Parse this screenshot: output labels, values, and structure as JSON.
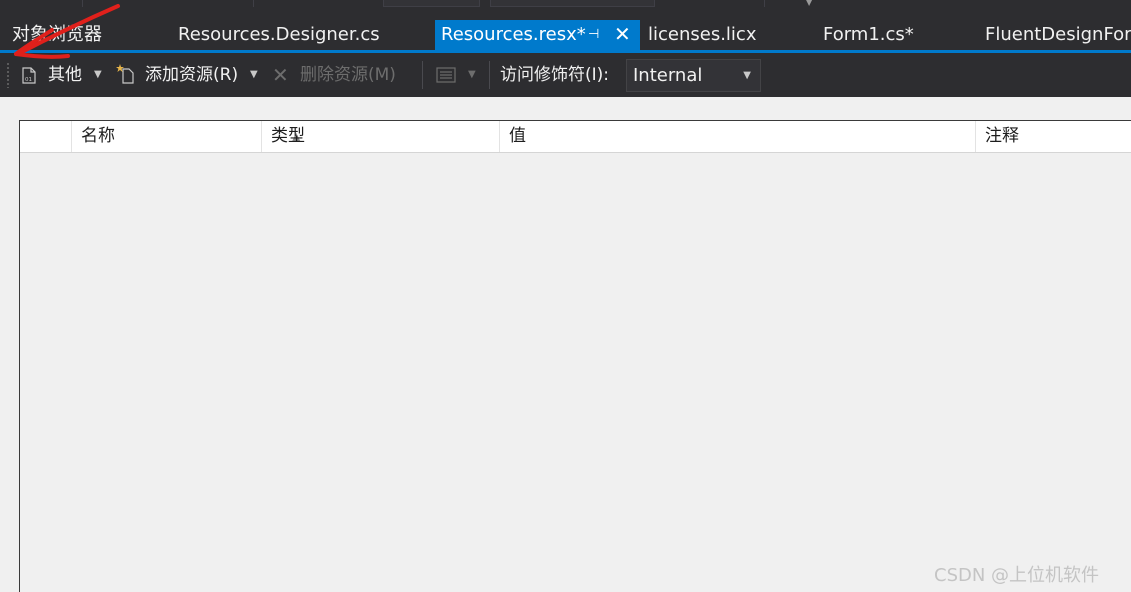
{
  "tabs": [
    {
      "label": "对象浏览器",
      "active": false
    },
    {
      "label": "Resources.Designer.cs",
      "active": false
    },
    {
      "label": "Resources.resx*",
      "active": true
    },
    {
      "label": "licenses.licx",
      "active": false
    },
    {
      "label": "Form1.cs*",
      "active": false
    },
    {
      "label": "FluentDesignForm",
      "active": false
    }
  ],
  "toolbar": {
    "other_label": "其他",
    "add_resource_label": "添加资源(R)",
    "remove_resource_label": "删除资源(M)",
    "access_modifier_label": "访问修饰符(I):",
    "access_modifier_value": "Internal"
  },
  "grid": {
    "columns": [
      "名称",
      "类型",
      "值",
      "注释"
    ]
  },
  "watermark": "CSDN @上位机软件",
  "colors": {
    "accent": "#007acc",
    "annotation": "#e0201b"
  }
}
